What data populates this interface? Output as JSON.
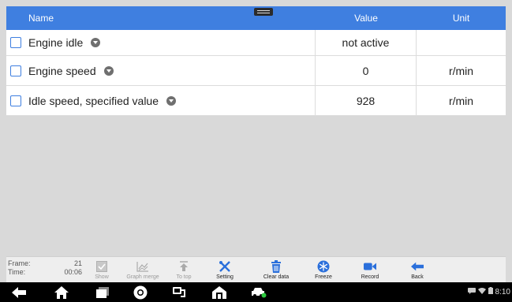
{
  "table": {
    "headers": {
      "name": "Name",
      "value": "Value",
      "unit": "Unit"
    },
    "rows": [
      {
        "name": "Engine idle",
        "value": "not active",
        "unit": ""
      },
      {
        "name": "Engine speed",
        "value": "0",
        "unit": "r/min"
      },
      {
        "name": "Idle speed, specified value",
        "value": "928",
        "unit": "r/min"
      }
    ]
  },
  "toolbar": {
    "frame_label": "Frame:",
    "frame_value": "21",
    "time_label": "Time:",
    "time_value": "00:06",
    "show": "Show",
    "graph_merge": "Graph merge",
    "to_top": "To top",
    "setting": "Setting",
    "clear_data": "Clear data",
    "freeze": "Freeze",
    "record": "Record",
    "back": "Back"
  },
  "statusbar": {
    "time": "8:10"
  },
  "colors": {
    "accent": "#3f7fe0",
    "background": "#d9d9d9",
    "navbar": "#000000"
  }
}
